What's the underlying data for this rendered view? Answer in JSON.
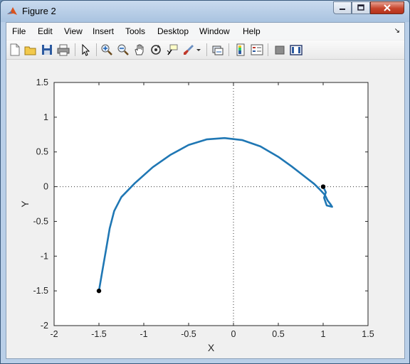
{
  "window": {
    "title": "Figure 2"
  },
  "menu": {
    "items": [
      "File",
      "Edit",
      "View",
      "Insert",
      "Tools",
      "Desktop",
      "Window",
      "Help"
    ]
  },
  "toolbar": {
    "buttons": [
      "new-figure",
      "open-file",
      "save",
      "print",
      "edit-plot",
      "zoom-in",
      "zoom-out",
      "pan",
      "rotate-3d",
      "data-cursor",
      "brush",
      "link-plot",
      "insert-colorbar",
      "insert-legend",
      "hide-plot-tools",
      "show-plot-tools"
    ]
  },
  "chart_data": {
    "type": "line",
    "xlabel": "X",
    "ylabel": "Y",
    "xlim": [
      -2,
      1.5
    ],
    "ylim": [
      -2,
      1.5
    ],
    "xticks": [
      -2,
      -1.5,
      -1,
      -0.5,
      0,
      0.5,
      1,
      1.5
    ],
    "yticks": [
      -2,
      -1.5,
      -1,
      -0.5,
      0,
      0.5,
      1,
      1.5
    ],
    "color": "#1f77b4",
    "series": [
      {
        "x": [
          -1.5,
          -1.46,
          -1.42,
          -1.38,
          -1.33,
          -1.25,
          -1.1,
          -0.9,
          -0.7,
          -0.5,
          -0.3,
          -0.1,
          0.1,
          0.3,
          0.5,
          0.65,
          0.8,
          0.9,
          0.97,
          1.02,
          1.05,
          1.08,
          1.1,
          1.04,
          1.01,
          1.03,
          1.0
        ],
        "y": [
          -1.5,
          -1.2,
          -0.9,
          -0.6,
          -0.35,
          -0.15,
          0.05,
          0.28,
          0.46,
          0.6,
          0.68,
          0.7,
          0.67,
          0.58,
          0.43,
          0.29,
          0.14,
          0.04,
          -0.05,
          -0.12,
          -0.2,
          -0.25,
          -0.29,
          -0.27,
          -0.16,
          -0.08,
          0.0
        ]
      }
    ],
    "markers": [
      {
        "x": -1.5,
        "y": -1.5
      },
      {
        "x": 1.0,
        "y": 0.0
      }
    ],
    "reference_lines": [
      {
        "orientation": "horizontal",
        "value": 0,
        "style": "dotted"
      },
      {
        "orientation": "vertical",
        "value": 0,
        "style": "dotted"
      }
    ],
    "grid": false,
    "box": true
  }
}
